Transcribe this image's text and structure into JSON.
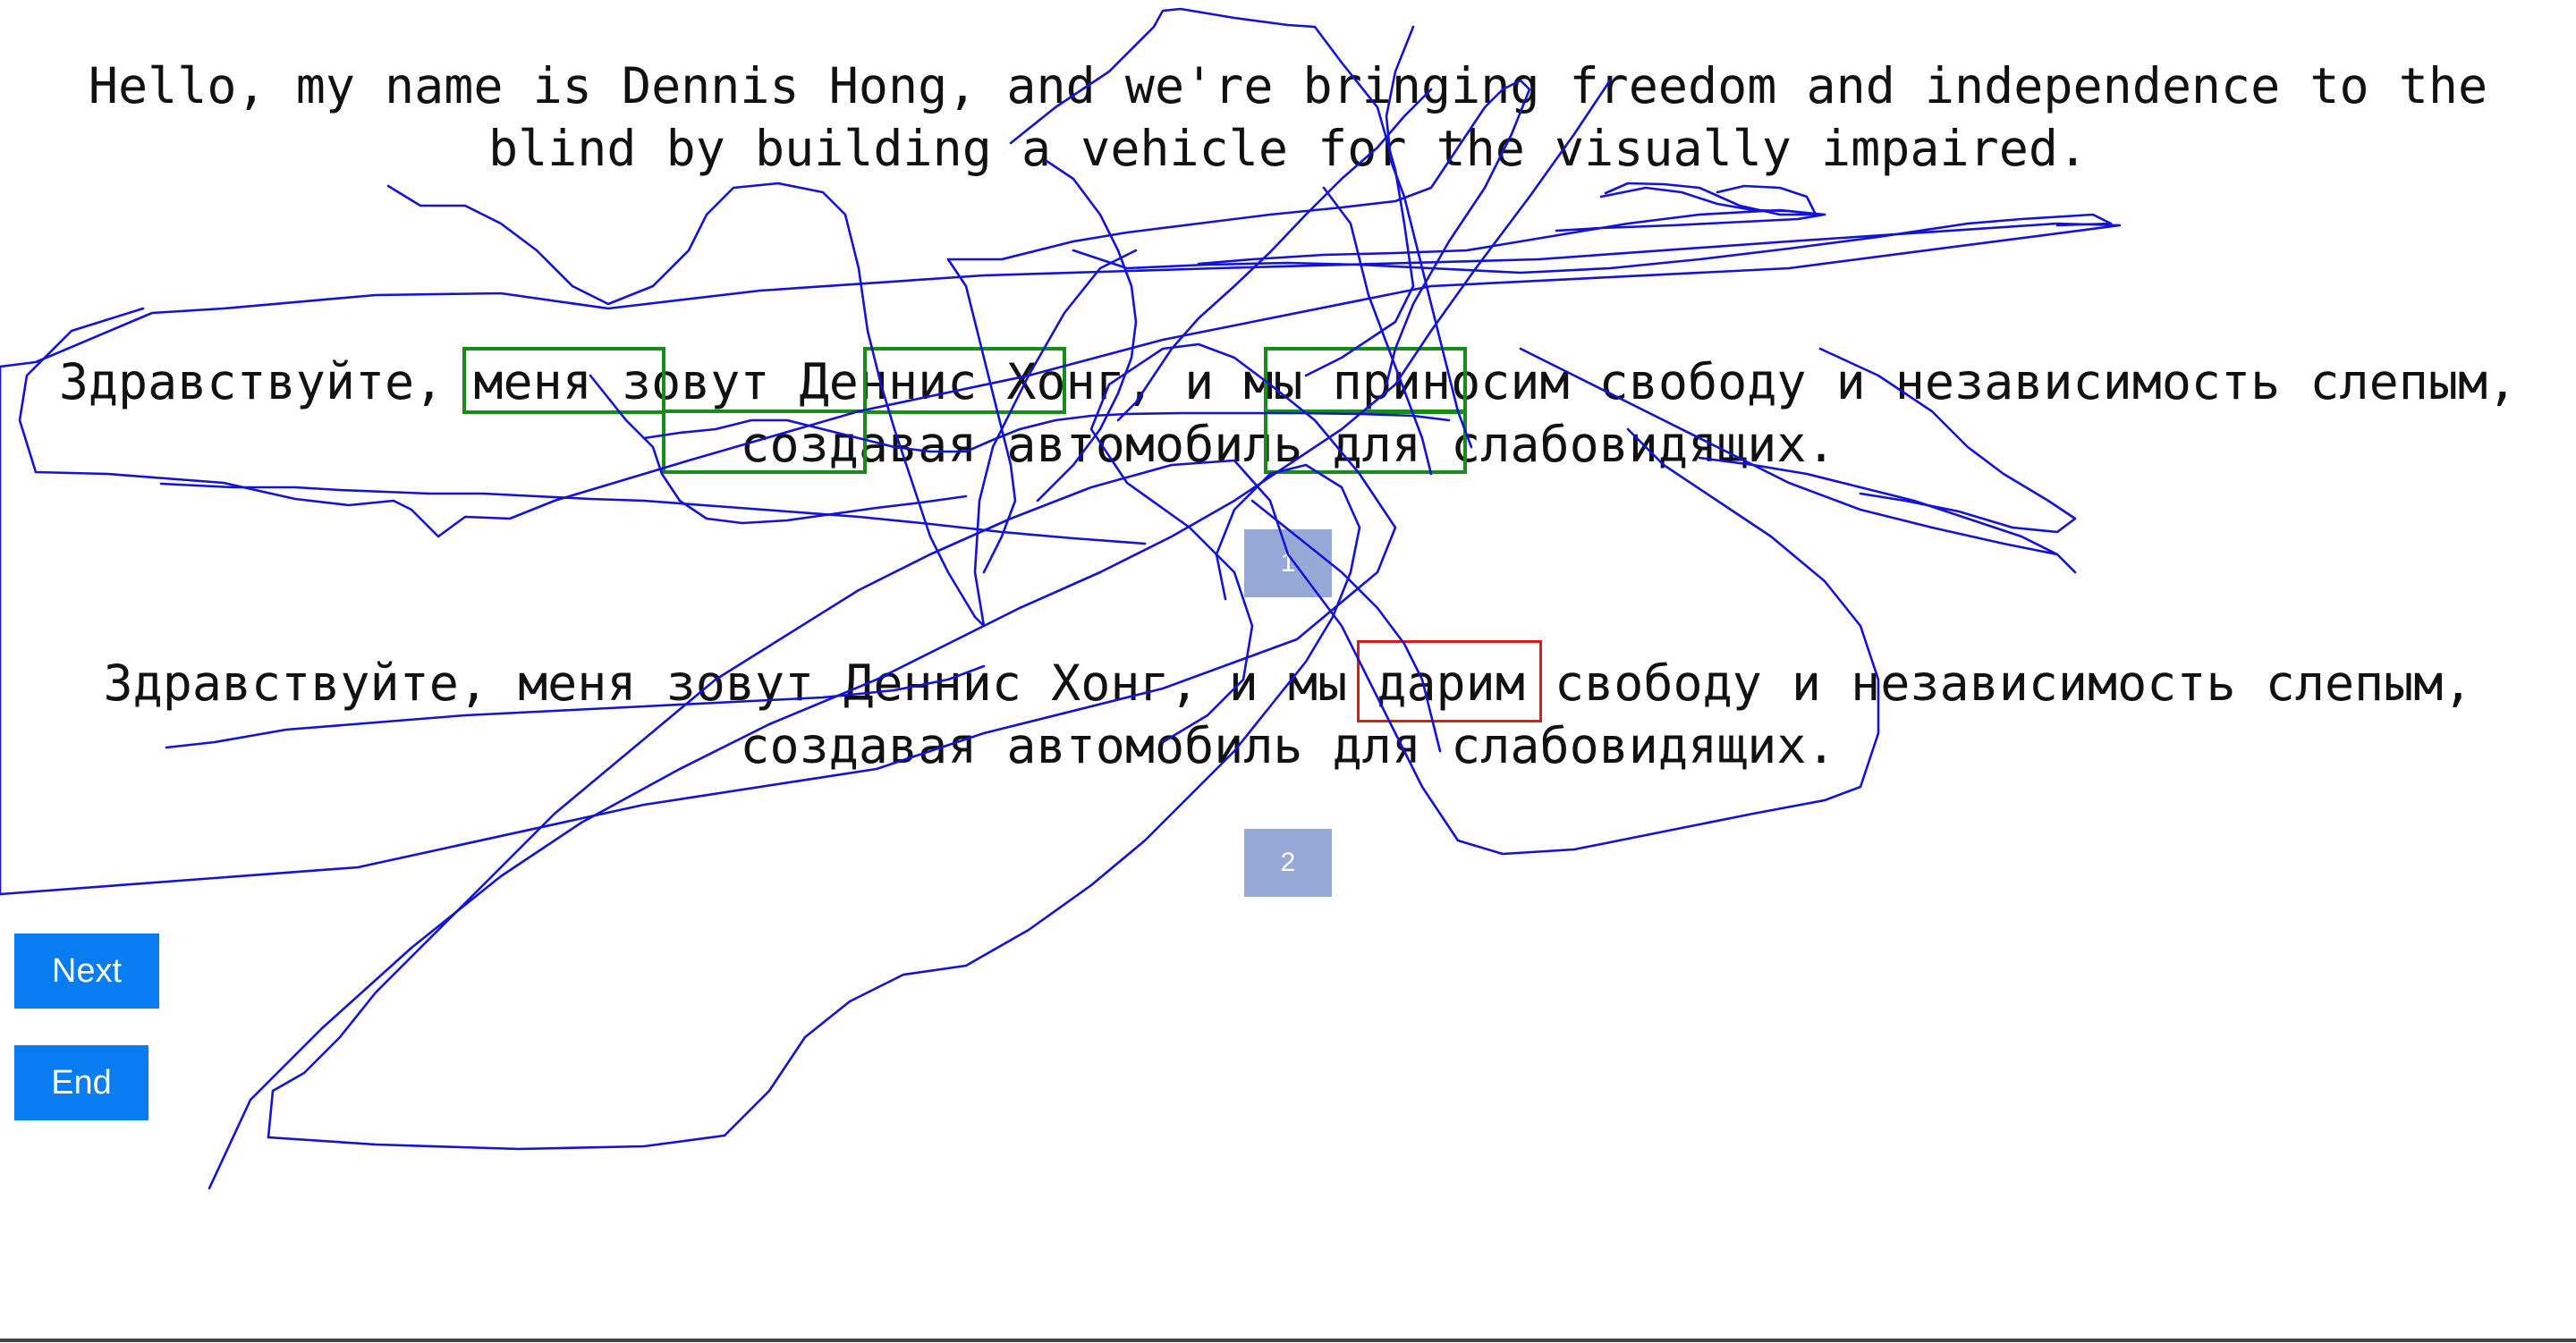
{
  "sentences": {
    "source": "Hello, my name is Dennis Hong, and we're bringing freedom and independence to the blind by building a vehicle for the visually impaired.",
    "translation_1": "Здравствуйте, меня зовут Деннис Хонг, и мы приносим свободу и независимость слепым, создавая автомобиль для слабовидящих.",
    "translation_2": "Здравствуйте, меня зовут Деннис Хонг, и мы дарим свободу и независимость слепым, создавая автомобиль для слабовидящих."
  },
  "badges": {
    "first": "1",
    "second": "2"
  },
  "buttons": {
    "next_label": "Next",
    "end_label": "End"
  },
  "colors": {
    "accent": "#0a7cf2",
    "badge": "#96a8d6",
    "match_highlight": "#1a8a1a",
    "diff_highlight": "#dd1a1a",
    "ink": "#1212d8"
  }
}
